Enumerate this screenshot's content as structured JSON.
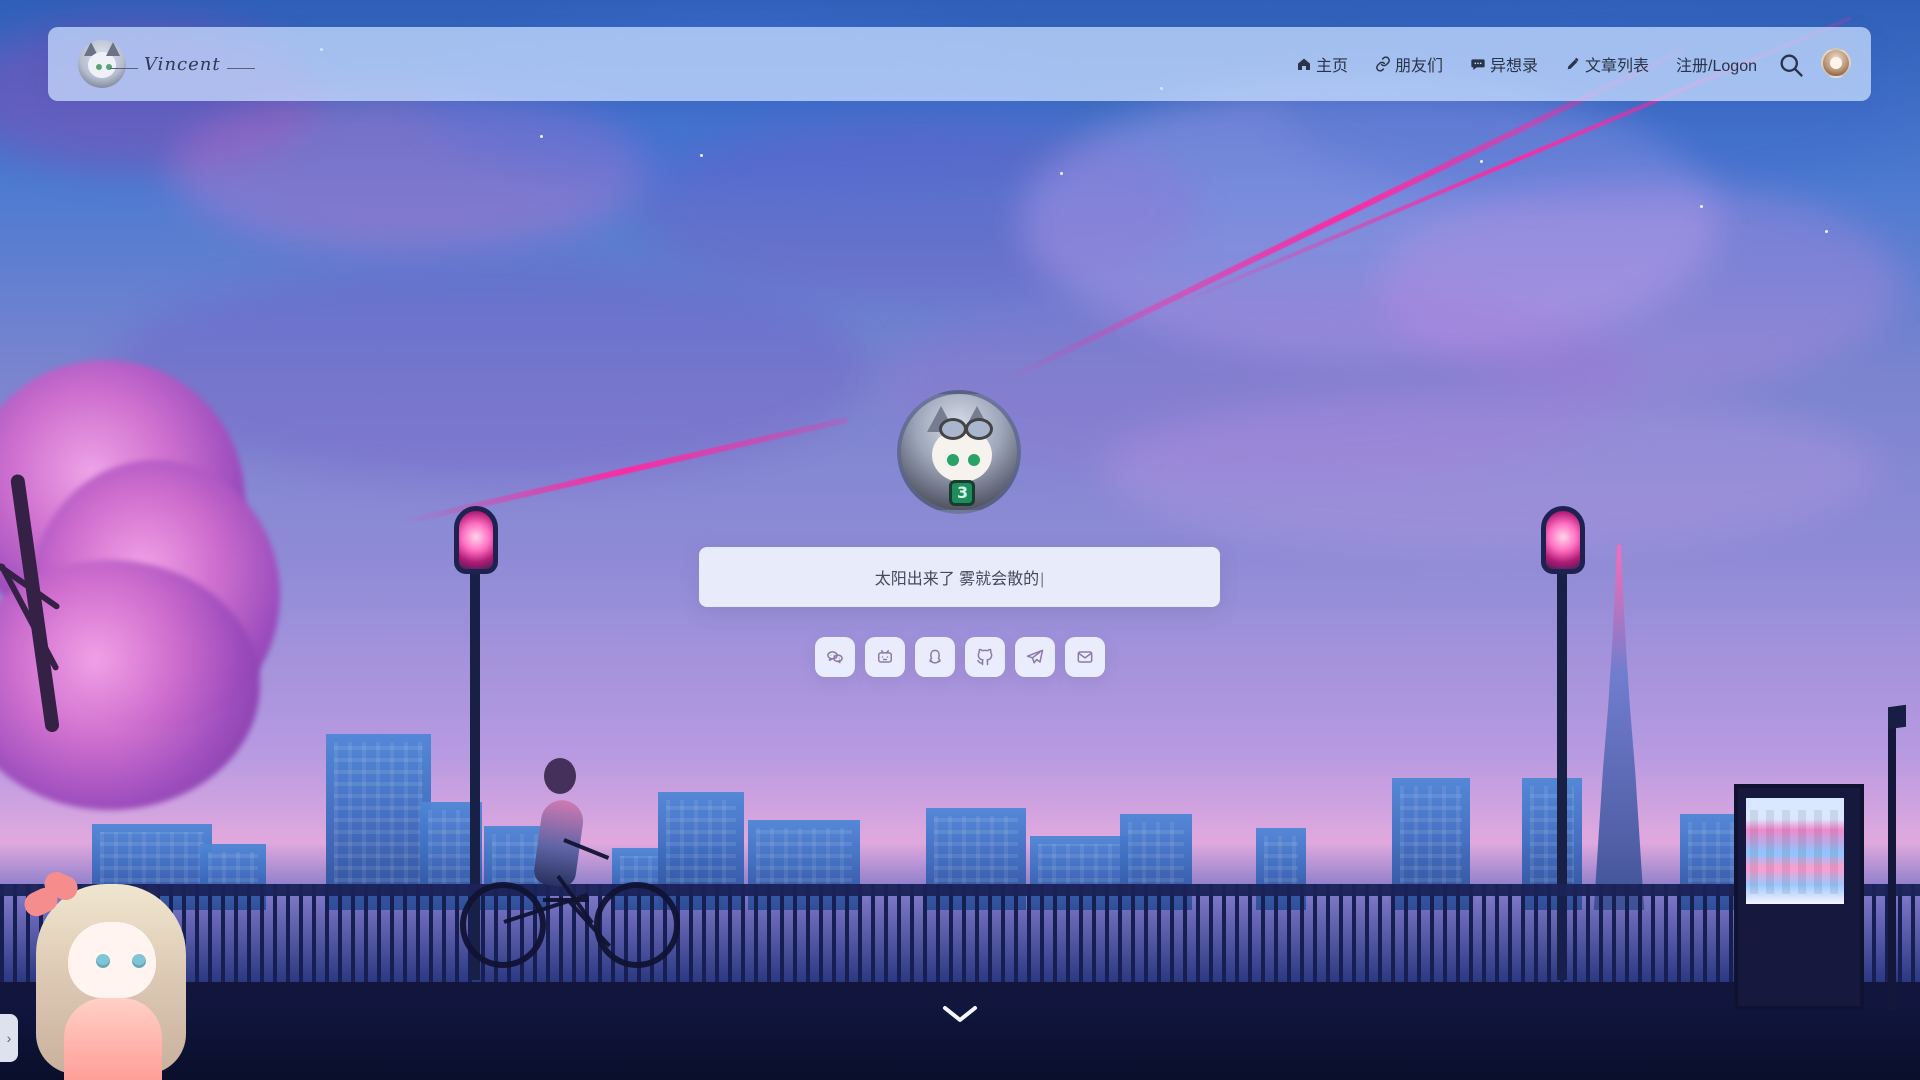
{
  "navbar": {
    "brand_logo": "cat-girl-avatar-logo",
    "brand_signature": "Vincent",
    "items": [
      {
        "label": "主页",
        "icon": "home-icon"
      },
      {
        "label": "朋友们",
        "icon": "link-icon"
      },
      {
        "label": "异想录",
        "icon": "chat-bubble-icon"
      },
      {
        "label": "文章列表",
        "icon": "pencil-icon"
      },
      {
        "label": "注册/Logon",
        "icon": ""
      }
    ],
    "search_icon": "search-icon",
    "user_avatar": "user-avatar"
  },
  "hero": {
    "avatar": "profile-avatar",
    "quote": "太阳出来了 雾就会散的"
  },
  "social": {
    "items": [
      {
        "name": "wechat",
        "icon": "wechat-icon"
      },
      {
        "name": "bilibili",
        "icon": "bilibili-icon"
      },
      {
        "name": "qq",
        "icon": "qq-icon"
      },
      {
        "name": "github",
        "icon": "github-icon"
      },
      {
        "name": "telegram",
        "icon": "telegram-icon"
      },
      {
        "name": "email",
        "icon": "mail-icon"
      }
    ]
  },
  "colors": {
    "navbar_bg": "#c9dfff",
    "nav_text": "#2a3347",
    "quote_bg": "#eff2fc",
    "social_icon": "#8d7aa8"
  }
}
